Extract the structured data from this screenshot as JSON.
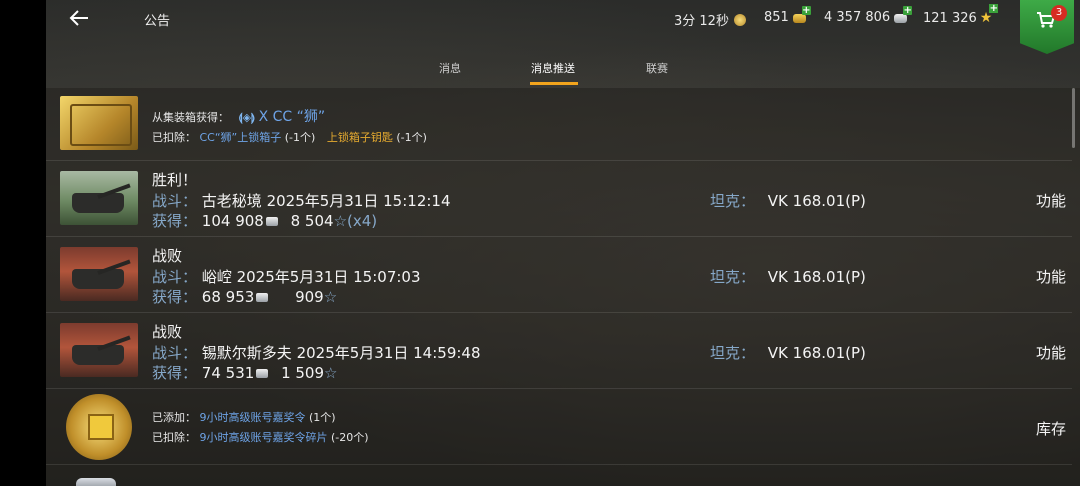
{
  "header": {
    "title": "公告",
    "timer": "3分 12秒",
    "gold": "851",
    "credits": "4 357 806",
    "free_xp": "121 326",
    "cart_badge": "3"
  },
  "tabs": [
    {
      "label": "消息",
      "active": false
    },
    {
      "label": "消息推送",
      "active": true
    },
    {
      "label": "联赛",
      "active": false
    }
  ],
  "rows": {
    "crate": {
      "gained_label": "从集装箱获得：",
      "gained_item": "X CC “狮”",
      "deducted_label": "已扣除：",
      "deducted_item1": "CC“狮”上锁箱子",
      "deducted_count1": "(-1个)",
      "deducted_item2": "上锁箱子钥匙",
      "deducted_count2": "(-1个)"
    },
    "battle1": {
      "result": "胜利！",
      "battle_label": "战斗：",
      "battle_info": "古老秘境 2025年5月31日 15:12:14",
      "earn_label": "获得：",
      "credits": "104 908",
      "xp": "8 504",
      "xp_mult": "(x4)",
      "tank_label": "坦克：",
      "tank": "VK 168.01(P)",
      "action": "功能"
    },
    "battle2": {
      "result": "战败",
      "battle_label": "战斗：",
      "battle_info": "峪崆 2025年5月31日 15:07:03",
      "earn_label": "获得：",
      "credits": "68 953",
      "xp": "909",
      "tank_label": "坦克：",
      "tank": "VK 168.01(P)",
      "action": "功能"
    },
    "battle3": {
      "result": "战败",
      "battle_label": "战斗：",
      "battle_info": "锡默尔斯多夫 2025年5月31日 14:59:48",
      "earn_label": "获得：",
      "credits": "74 531",
      "xp": "1 509",
      "tank_label": "坦克：",
      "tank": "VK 168.01(P)",
      "action": "功能"
    },
    "premium": {
      "added_label": "已添加：",
      "added_item": "9小时高级账号嘉奖令",
      "added_count": "(1个)",
      "deducted_label": "已扣除：",
      "deducted_item": "9小时高级账号嘉奖令碎片",
      "deducted_count": "(-20个)",
      "action": "库存"
    }
  }
}
